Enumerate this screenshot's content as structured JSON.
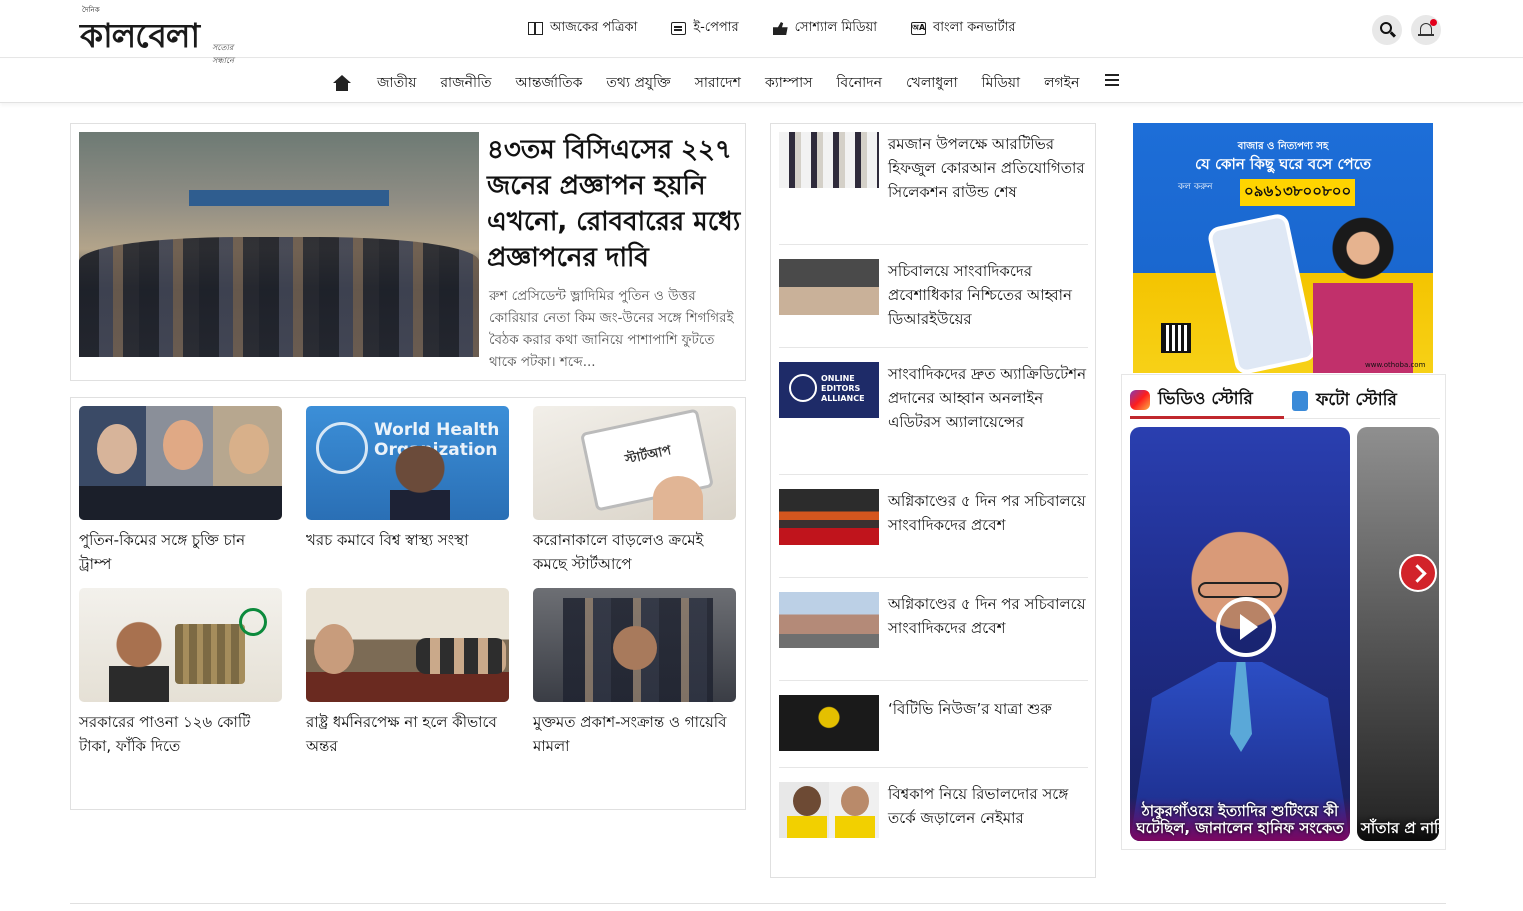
{
  "brand": {
    "small": "দৈনিক",
    "name": "কালবেলা",
    "tagline": "সত্যের সন্ধানে"
  },
  "toplinks": [
    {
      "label": "আজকের পত্রিকা",
      "icon": "newspaper-grid-icon"
    },
    {
      "label": "ই-পেপার",
      "icon": "epaper-icon"
    },
    {
      "label": "সোশ্যাল মিডিয়া",
      "icon": "thumbs-up-icon"
    },
    {
      "label": "বাংলা কনভার্টার",
      "icon": "language-converter-icon"
    }
  ],
  "nav": {
    "items": [
      "জাতীয়",
      "রাজনীতি",
      "আন্তর্জাতিক",
      "তথ্য প্রযুক্তি",
      "সারাদেশ",
      "ক্যাম্পাস",
      "বিনোদন",
      "খেলাধুলা",
      "মিডিয়া",
      "লগইন"
    ]
  },
  "lead": {
    "title": "৪৩তম বিসিএসের ২২৭ জনের প্রজ্ঞাপন হয়নি এখনো, রোববারের মধ্যে প্রজ্ঞাপনের দাবি",
    "summary": "রুশ প্রেসিডেন্ট ভ্লাদিমির পুতিন ও উত্তর কোরিয়ার নেতা কিম জং-উনের সঙ্গে শিগগিরই বৈঠক করার কথা জানিয়ে পাশাপাশি ফুটতে থাকে পটকা। শব্দে..."
  },
  "grid": [
    {
      "title": "পুতিন-কিমের সঙ্গে চুক্তি চান ট্রাম্প"
    },
    {
      "title": "খরচ কমাবে বিশ্ব স্বাস্থ্য সংস্থা",
      "image_text": "World Health Organization"
    },
    {
      "title": "করোনাকালে বাড়লেও ক্রমেই কমছে স্টার্টআপে",
      "image_text": "স্টার্টআপ"
    },
    {
      "title": "সরকারের পাওনা ১২৬ কোটি টাকা, ফাঁকি দিতে"
    },
    {
      "title": "রাষ্ট্র ধর্মনিরপেক্ষ না হলে কীভাবে অন্তর"
    },
    {
      "title": "মুক্তমত প্রকাশ-সংক্রান্ত ও গায়েবি মামলা"
    }
  ],
  "list": [
    {
      "title": "রমজান উপলক্ষে আরটিভির হিফজুল কোরআন প্রতিযোগিতার সিলেকশন রাউন্ড শেষ"
    },
    {
      "title": "সচিবালয়ে সাংবাদিকদের প্রবেশাধিকার নিশ্চিতের আহ্বান ডিআরইউয়ের"
    },
    {
      "title": "সাংবাদিকদের দ্রুত অ্যাক্রিডিটেশন প্রদানের আহ্বান অনলাইন এডিটরস অ্যালায়েন্সের",
      "image_text": "ONLINE EDITORS ALLIANCE"
    },
    {
      "title": "অগ্নিকাণ্ডের ৫ দিন পর সচিবালয়ে সাংবাদিকদের প্রবেশ"
    },
    {
      "title": "অগ্নিকাণ্ডের ৫ দিন পর সচিবালয়ে সাংবাদিকদের প্রবেশ"
    },
    {
      "title": "‘বিটিভি নিউজ’র যাত্রা শুরু"
    },
    {
      "title": "বিশ্বকাপ নিয়ে রিভালদোর সঙ্গে তর্কে জড়ালেন নেইমার"
    }
  ],
  "ad": {
    "small": "বাজার ও নিত্যপণ্য সহ",
    "headline": "যে কোন কিছু ঘরে বসে পেতে",
    "call": "কল করুন",
    "phone": "০৯৬১৩৮০০৮০০",
    "url": "www.othoba.com"
  },
  "stories": {
    "tabs": [
      "ভিডিও স্টোরি",
      "ফটো স্টোরি"
    ],
    "cards": [
      {
        "caption": "ঠাকুরগাঁওয়ে ইত্যাদির শুটিংয়ে কী ঘটেছিল, জানালেন হানিফ সংকেত"
      },
      {
        "caption": "সাঁতার প্র নাফিসা দি না"
      }
    ]
  },
  "colors": {
    "accent": "#d2232a",
    "tab_underline": "#c0272d",
    "ad_blue": "#1d6ed8",
    "ad_yellow": "#f4c400"
  }
}
